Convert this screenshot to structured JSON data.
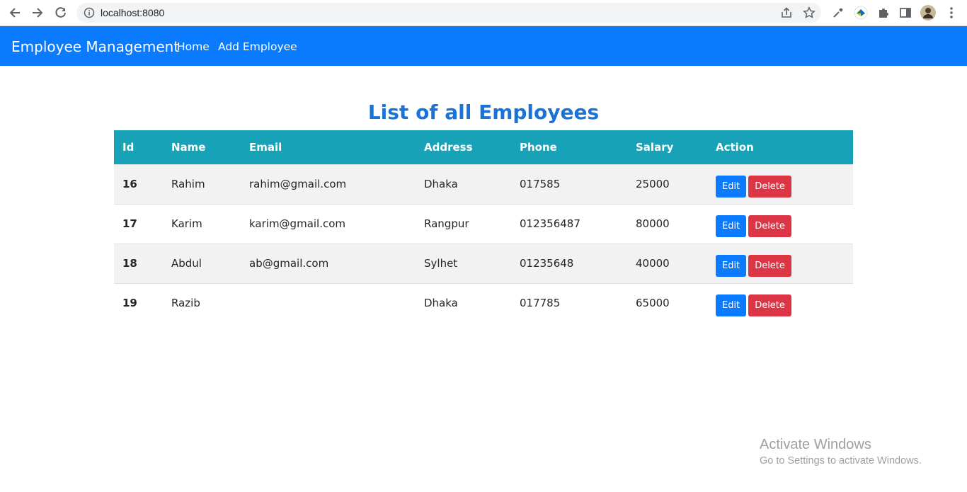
{
  "browser": {
    "url": "localhost:8080"
  },
  "navbar": {
    "brand": "Employee Management",
    "links": [
      "Home",
      "Add Employee"
    ],
    "color": "#0a7bff"
  },
  "page": {
    "title": "List of all Employees"
  },
  "table": {
    "header_color": "#17a2b8",
    "columns": [
      "Id",
      "Name",
      "Email",
      "Address",
      "Phone",
      "Salary",
      "Action"
    ],
    "rows": [
      {
        "id": "16",
        "name": "Rahim",
        "email": "rahim@gmail.com",
        "address": "Dhaka",
        "phone": "017585",
        "salary": "25000"
      },
      {
        "id": "17",
        "name": "Karim",
        "email": "karim@gmail.com",
        "address": "Rangpur",
        "phone": "012356487",
        "salary": "80000"
      },
      {
        "id": "18",
        "name": "Abdul",
        "email": "ab@gmail.com",
        "address": "Sylhet",
        "phone": "01235648",
        "salary": "40000"
      },
      {
        "id": "19",
        "name": "Razib",
        "email": "",
        "address": "Dhaka",
        "phone": "017785",
        "salary": "65000"
      }
    ],
    "edit_label": "Edit",
    "delete_label": "Delete"
  },
  "watermark": {
    "line1": "Activate Windows",
    "line2": "Go to Settings to activate Windows."
  }
}
